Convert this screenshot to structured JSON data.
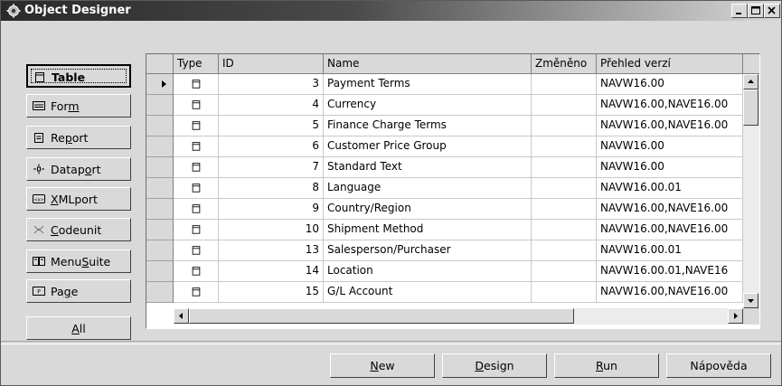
{
  "window": {
    "title": "Object Designer",
    "caption_buttons": [
      "minimize",
      "maximize",
      "close"
    ]
  },
  "object_types": [
    {
      "label_pre": "",
      "label_u": "",
      "label_post": "Table",
      "icon": "table-icon",
      "selected": true,
      "name": "table"
    },
    {
      "label_pre": "For",
      "label_u": "m",
      "label_post": "",
      "icon": "form-icon",
      "selected": false,
      "name": "form"
    },
    {
      "label_pre": "Re",
      "label_u": "p",
      "label_post": "ort",
      "icon": "report-icon",
      "selected": false,
      "name": "report"
    },
    {
      "label_pre": "Datap",
      "label_u": "o",
      "label_post": "rt",
      "icon": "dataport-icon",
      "selected": false,
      "name": "dataport"
    },
    {
      "label_pre": "",
      "label_u": "X",
      "label_post": "MLport",
      "icon": "xmlport-icon",
      "selected": false,
      "name": "xmlport"
    },
    {
      "label_pre": "",
      "label_u": "C",
      "label_post": "odeunit",
      "icon": "codeunit-icon",
      "selected": false,
      "name": "codeunit"
    },
    {
      "label_pre": "Menu",
      "label_u": "S",
      "label_post": "uite",
      "icon": "menusuite-icon",
      "selected": false,
      "name": "menusuite"
    },
    {
      "label_pre": "Pa",
      "label_u": "g",
      "label_post": "e",
      "icon": "page-icon",
      "selected": false,
      "name": "page"
    },
    {
      "label_pre": "",
      "label_u": "A",
      "label_post": "ll",
      "icon": "",
      "selected": false,
      "name": "all"
    }
  ],
  "table": {
    "columns": [
      "Type",
      "ID",
      "Name",
      "Změněno",
      "Přehled verzí"
    ],
    "rows": [
      {
        "id": "3",
        "name": "Payment Terms",
        "changed": "",
        "versions": "NAVW16.00"
      },
      {
        "id": "4",
        "name": "Currency",
        "changed": "",
        "versions": "NAVW16.00,NAVE16.00"
      },
      {
        "id": "5",
        "name": "Finance Charge Terms",
        "changed": "",
        "versions": "NAVW16.00,NAVE16.00"
      },
      {
        "id": "6",
        "name": "Customer Price Group",
        "changed": "",
        "versions": "NAVW16.00"
      },
      {
        "id": "7",
        "name": "Standard Text",
        "changed": "",
        "versions": "NAVW16.00"
      },
      {
        "id": "8",
        "name": "Language",
        "changed": "",
        "versions": "NAVW16.00.01"
      },
      {
        "id": "9",
        "name": "Country/Region",
        "changed": "",
        "versions": "NAVW16.00,NAVE16.00"
      },
      {
        "id": "10",
        "name": "Shipment Method",
        "changed": "",
        "versions": "NAVW16.00,NAVE16.00"
      },
      {
        "id": "13",
        "name": "Salesperson/Purchaser",
        "changed": "",
        "versions": "NAVW16.00.01"
      },
      {
        "id": "14",
        "name": "Location",
        "changed": "",
        "versions": "NAVW16.00.01,NAVE16"
      },
      {
        "id": "15",
        "name": "G/L Account",
        "changed": "",
        "versions": "NAVW16.00,NAVE16.00"
      }
    ],
    "current_row_index": 0,
    "row_type_icon": "table-icon"
  },
  "buttons": {
    "new_pre": "",
    "new_u": "N",
    "new_post": "ew",
    "design_pre": "",
    "design_u": "D",
    "design_post": "esign",
    "run_pre": "",
    "run_u": "R",
    "run_post": "un",
    "help": "Nápověda"
  }
}
